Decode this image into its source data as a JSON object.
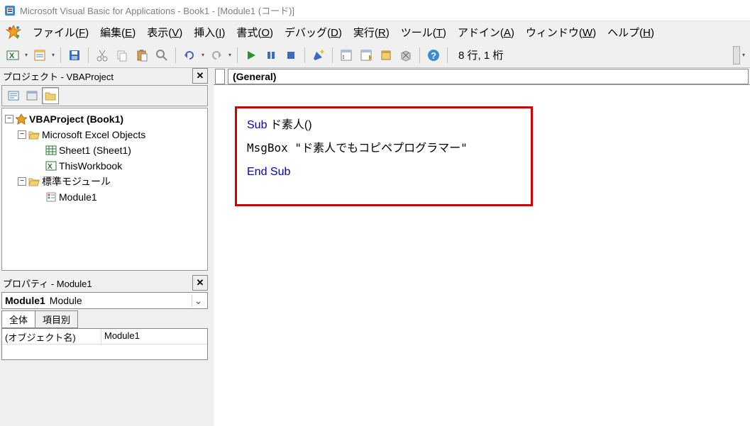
{
  "title": "Microsoft Visual Basic for Applications - Book1 - [Module1 (コード)]",
  "menus": {
    "file": {
      "label": "ファイル(",
      "u": "F",
      "tail": ")"
    },
    "edit": {
      "label": "編集(",
      "u": "E",
      "tail": ")"
    },
    "view": {
      "label": "表示(",
      "u": "V",
      "tail": ")"
    },
    "insert": {
      "label": "挿入(",
      "u": "I",
      "tail": ")"
    },
    "format": {
      "label": "書式(",
      "u": "O",
      "tail": ")"
    },
    "debug": {
      "label": "デバッグ(",
      "u": "D",
      "tail": ")"
    },
    "run": {
      "label": "実行(",
      "u": "R",
      "tail": ")"
    },
    "tools": {
      "label": "ツール(",
      "u": "T",
      "tail": ")"
    },
    "addin": {
      "label": "アドイン(",
      "u": "A",
      "tail": ")"
    },
    "window": {
      "label": "ウィンドウ(",
      "u": "W",
      "tail": ")"
    },
    "help": {
      "label": "ヘルプ(",
      "u": "H",
      "tail": ")"
    }
  },
  "toolbar": {
    "position": "8 行, 1 桁"
  },
  "project_pane": {
    "title": "プロジェクト - VBAProject",
    "tree": {
      "project": "VBAProject (Book1)",
      "excel_objects": "Microsoft Excel Objects",
      "sheet1": "Sheet1 (Sheet1)",
      "thisworkbook": "ThisWorkbook",
      "std_modules": "標準モジュール",
      "module1": "Module1"
    }
  },
  "properties_pane": {
    "title": "プロパティ - Module1",
    "object_name": "Module1",
    "object_type": "Module",
    "tabs": {
      "all": "全体",
      "categorized": "項目別"
    },
    "rows": [
      {
        "k": "(オブジェクト名)",
        "v": "Module1"
      }
    ]
  },
  "code_pane": {
    "left_combo": "(General)",
    "code": {
      "l1a": "Sub",
      "l1b": " ド素人()",
      "l2": "MsgBox \"ド素人でもコピペプログラマー\"",
      "l3": "End Sub"
    }
  }
}
